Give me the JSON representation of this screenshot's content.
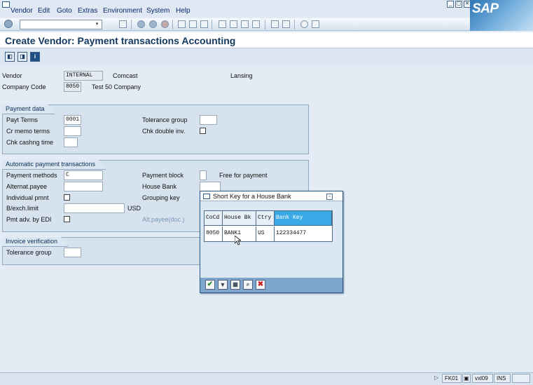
{
  "menu": {
    "items": [
      "Vendor",
      "Edit",
      "Goto",
      "Extras",
      "Environment",
      "System",
      "Help"
    ]
  },
  "logo": "SAP",
  "title": "Create Vendor: Payment transactions Accounting",
  "header": {
    "vendor_label": "Vendor",
    "vendor_value": "INTERNAL",
    "vendor_name": "Comcast",
    "vendor_city": "Lansing",
    "company_code_label": "Company Code",
    "company_code_value": "8050",
    "company_name": "Test 50 Company"
  },
  "payment_data": {
    "title": "Payment data",
    "payt_terms_label": "Payt Terms",
    "payt_terms_value": "0001",
    "cr_memo_label": "Cr memo terms",
    "chk_cashing_label": "Chk cashng time",
    "tolerance_group_label": "Tolerance group",
    "chk_double_label": "Chk double inv."
  },
  "auto_payment": {
    "title": "Automatic payment transactions",
    "payment_methods_label": "Payment methods",
    "payment_methods_value": "C",
    "alternat_payee_label": "Alternat.payee",
    "individual_pmnt_label": "Individual pmnt",
    "bexch_limit_label": "B/exch.limit",
    "currency": "USD",
    "pmt_adv_label": "Pmt adv. by EDI",
    "payment_block_label": "Payment block",
    "free_for_payment": "Free for payment",
    "house_bank_label": "House Bank",
    "grouping_key_label": "Grouping key",
    "alt_payee_doc_label": "Alt.payee(doc.)"
  },
  "invoice_verification": {
    "title": "Invoice verification",
    "tolerance_group_label": "Tolerance group"
  },
  "popup": {
    "title": "Short Key for a House Bank",
    "columns": [
      "CoCd",
      "House Bk",
      "Ctry",
      "Bank Key"
    ],
    "row": [
      "8050",
      "BANK1",
      "US",
      "122334477"
    ]
  },
  "status": {
    "transaction": "FK01",
    "server": "vxl09",
    "mode": "INS"
  }
}
